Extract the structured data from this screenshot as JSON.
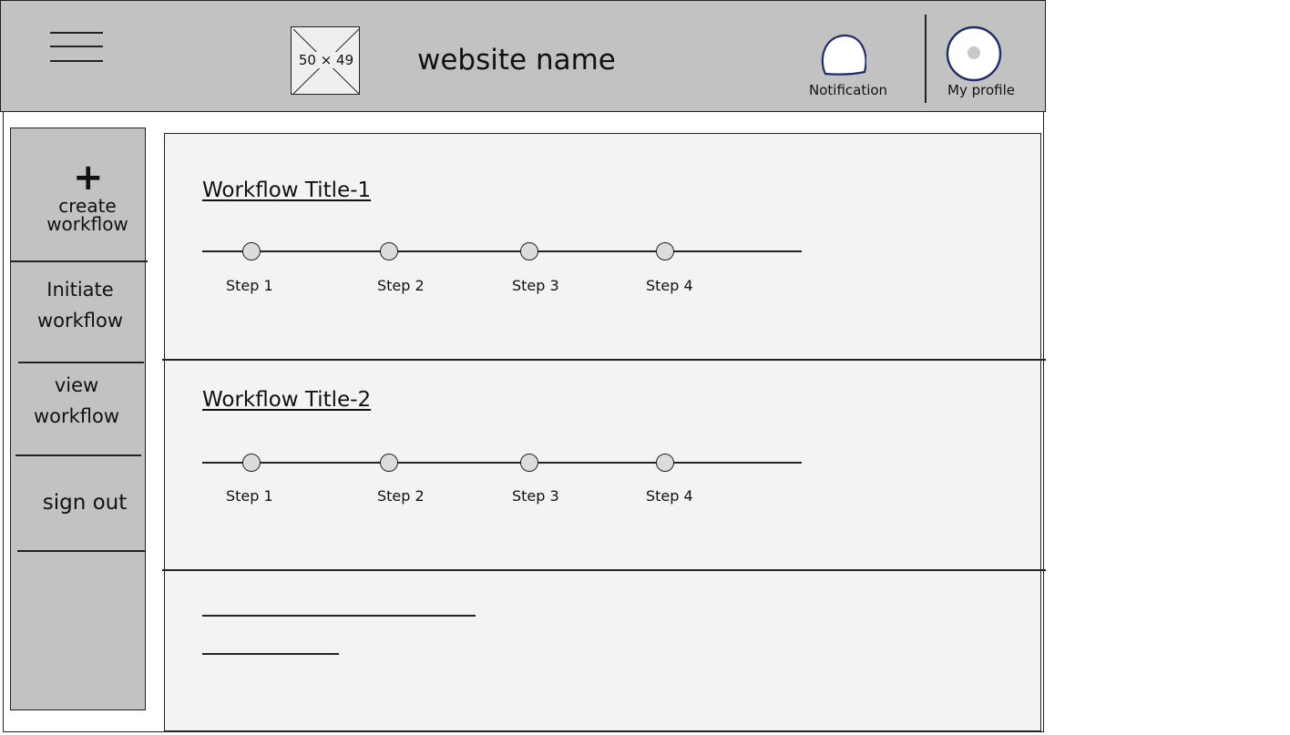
{
  "header": {
    "logo_placeholder": "50 × 49",
    "site_name": "website name",
    "notification_label": "Notification",
    "profile_label": "My profile"
  },
  "sidebar": {
    "create": {
      "icon": "plus-icon",
      "line1": "create",
      "line2": "workflow"
    },
    "initiate": {
      "line1": "Initiate",
      "line2": "workflow"
    },
    "view": {
      "line1": "view",
      "line2": "workflow"
    },
    "signout": "sign out"
  },
  "workflows": [
    {
      "title": "Workflow Title-1",
      "steps": [
        "Step 1",
        "Step 2",
        "Step 3",
        "Step 4"
      ]
    },
    {
      "title": "Workflow Title-2",
      "steps": [
        "Step 1",
        "Step 2",
        "Step 3",
        "Step 4"
      ]
    }
  ],
  "colors": {
    "header_bg": "#c2c2c2",
    "sidebar_bg": "#c2c2c2",
    "main_bg": "#f3f3f3",
    "icon_stroke": "#1f2d6b"
  }
}
